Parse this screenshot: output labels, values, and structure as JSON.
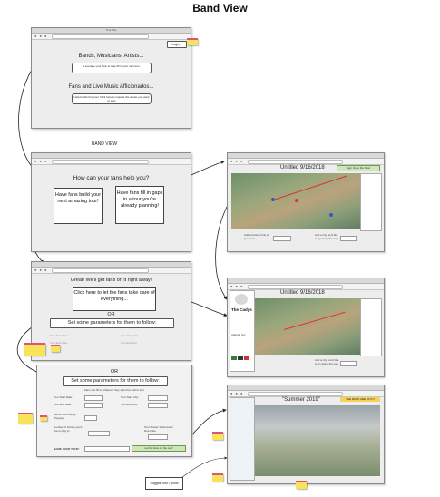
{
  "page": {
    "title": "Band View"
  },
  "win1": {
    "tab_title": "Tour Trip",
    "login_label": "Login ▾",
    "section1_heading": "Bands, Musicians, Artists...",
    "section1_button": "Leverage your fans to help fill in your next tour",
    "section2_heading": "Fans and Live Music Afficionados...",
    "section2_button": "Help bands find you! Click here to request the shows you want to see!"
  },
  "win2": {
    "caption": "BAND VIEW",
    "heading": "How can your fans help you?",
    "option1": "Have fans build your next amazing tour!",
    "option2": "Have fans fill in gaps in a tour you're already planning!"
  },
  "win3": {
    "heading": "Great! We'll get fans on it right away!",
    "action_box": "Click here to let the fans take care of everything...",
    "or_label": "OR",
    "params_button": "Set some parameters for them to follow:",
    "ghost1": "Tour Start Date",
    "ghost2": "Tour Start City",
    "ghost3": "Tour End Date",
    "ghost4": "Tour End City"
  },
  "win4": {
    "or_label": "OR",
    "params_button": "Set some parameters for them to follow:",
    "subtitle": "Fans can fill in whatever they want but add to tour",
    "start_date_label": "Tour Start Date:",
    "end_date_label": "Tour End Date:",
    "start_city_label": "Tour Start City:",
    "end_city_label": "Tour End City:",
    "venue_size_label": "Venue Size Range (People):",
    "shows_label": "Number of shows you'd like to play in:",
    "deadline_label": "Tour Roster Submission Due Date:",
    "name_label": "NAME YOUR TOUR:",
    "submit_button": "Let the fans do the rest!"
  },
  "map1": {
    "title": "Untitled 9/16/2018",
    "signup": "Sign Up to the Next",
    "add_bottom_left": "Add a bottom limit to your tour",
    "add_bottom_right": "Add a city we'd like to try along the way"
  },
  "map2": {
    "title": "Untitled 9/16/2018",
    "band_name": "The Cadys",
    "location": "Atlanta, GA",
    "add_city": "Add a city you'd like to try along the way"
  },
  "map3": {
    "title": "\"Summer 2019\"",
    "badge": "THE BAND ARE ON IT!"
  },
  "callout": {
    "text": "Suggest tour / show"
  },
  "colors": {
    "accent_red": "#dd3333",
    "pin_blue": "#3355cc",
    "sticky_yellow": "#f7e45a",
    "button_green": "#cfe6b8"
  }
}
